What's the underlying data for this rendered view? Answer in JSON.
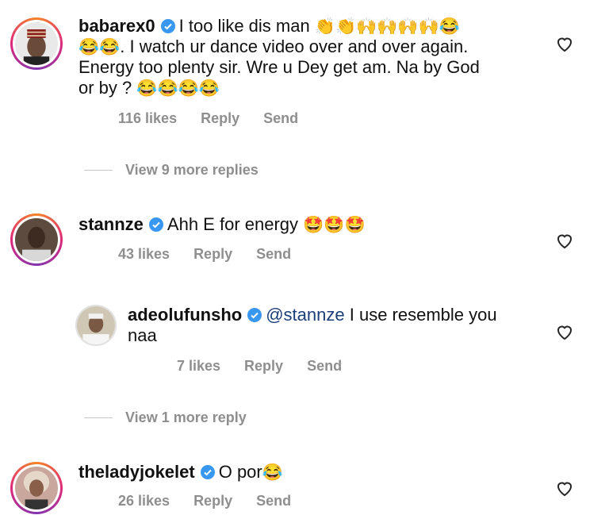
{
  "comments": [
    {
      "username": "babarex0",
      "text_line1": "I too like dis man",
      "emoji_line1": "👏👏🙌🙌🙌🙌😂",
      "text_line2a": "😂😂",
      "text_line2b": ". I watch ur dance video over and over again.",
      "text_line3": "Energy too plenty sir.  Wre u Dey get am.  Na by God",
      "text_line4": "or by ?",
      "emoji_line4": "😂😂😂😂",
      "likes": "116 likes",
      "reply": "Reply",
      "send": "Send"
    },
    {
      "username": "stannze",
      "text": "Ahh E for energy",
      "emoji": "🤩🤩🤩",
      "likes": "43 likes",
      "reply": "Reply",
      "send": "Send"
    },
    {
      "username": "adeolufunsho",
      "mention": "@stannze",
      "text_line1": "I use resemble you",
      "text_line2": "naa",
      "likes": "7 likes",
      "reply": "Reply",
      "send": "Send"
    },
    {
      "username": "theladyjokelet",
      "text": "O por",
      "emoji": "😂",
      "likes": "26 likes",
      "reply": "Reply",
      "send": "Send"
    }
  ],
  "view_more": [
    "View 9 more replies",
    "View 1 more reply"
  ]
}
